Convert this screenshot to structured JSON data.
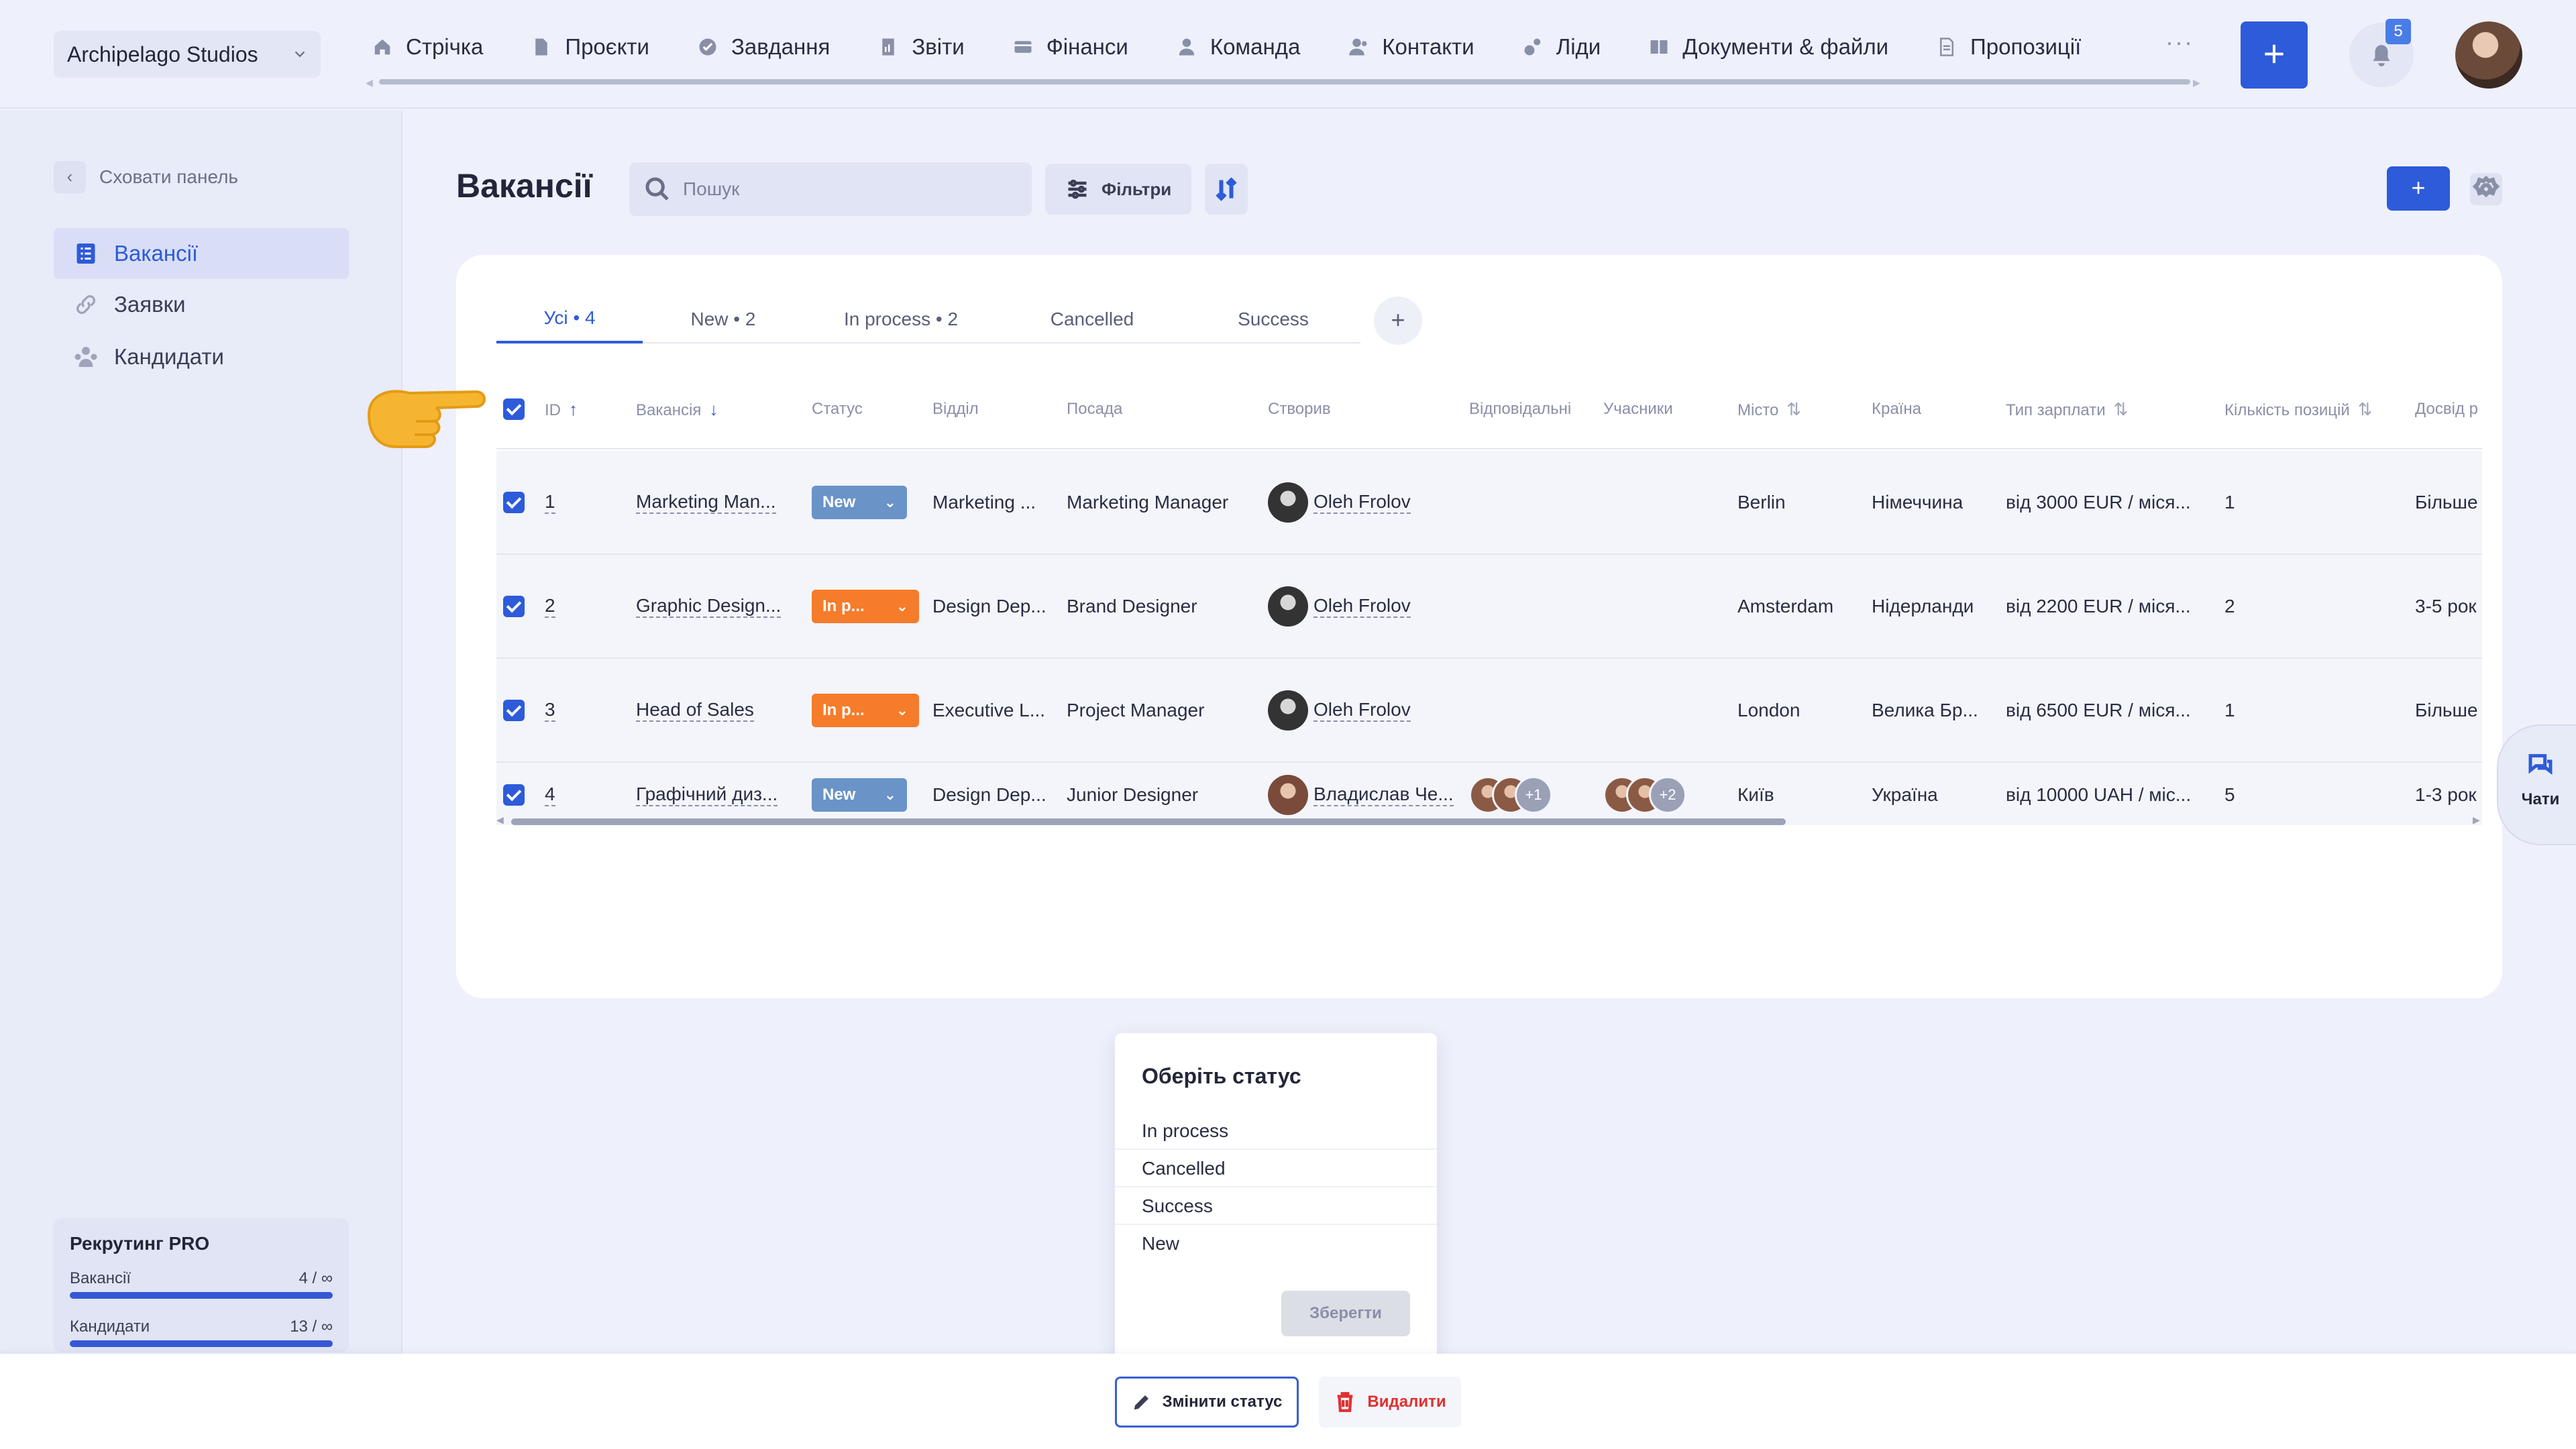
{
  "header": {
    "workspace": "Archipelago Studios",
    "nav": [
      {
        "label": "Стрічка",
        "icon": "home-icon"
      },
      {
        "label": "Проєкти",
        "icon": "file-icon"
      },
      {
        "label": "Завдання",
        "icon": "check-circle-icon"
      },
      {
        "label": "Звіти",
        "icon": "report-icon"
      },
      {
        "label": "Фінанси",
        "icon": "wallet-icon"
      },
      {
        "label": "Команда",
        "icon": "user-icon"
      },
      {
        "label": "Контакти",
        "icon": "contacts-icon"
      },
      {
        "label": "Ліди",
        "icon": "leads-icon"
      },
      {
        "label": "Документи & файли",
        "icon": "book-icon"
      },
      {
        "label": "Пропозиції",
        "icon": "document-icon"
      }
    ],
    "more": "···",
    "add_label": "+",
    "notifications_count": "5"
  },
  "sidebar": {
    "collapse_label": "Сховати панель",
    "items": [
      {
        "label": "Вакансії",
        "icon": "list-icon",
        "active": true
      },
      {
        "label": "Заявки",
        "icon": "link-icon",
        "active": false
      },
      {
        "label": "Кандидати",
        "icon": "people-icon",
        "active": false
      }
    ],
    "plan": {
      "title": "Рекрутинг PRO",
      "rows": [
        {
          "label": "Вакансії",
          "value": "4 / ∞"
        },
        {
          "label": "Кандидати",
          "value": "13 / ∞"
        }
      ]
    }
  },
  "main": {
    "title": "Вакансії",
    "search_placeholder": "Пошук",
    "filters_label": "Фільтри",
    "add_label": "+",
    "tabs": [
      "Усі • 4",
      "New • 2",
      "In process • 2",
      "Cancelled",
      "Success"
    ],
    "tab_add": "+",
    "columns": [
      "ID",
      "Вакансія",
      "Статус",
      "Відділ",
      "Посада",
      "Створив",
      "Відповідальні",
      "Учасники",
      "Місто",
      "Країна",
      "Тип зарплати",
      "Кількість позицій",
      "Досвід р"
    ],
    "rows": [
      {
        "id": "1",
        "vacancy": "Marketing Man...",
        "status": "New",
        "department": "Marketing ...",
        "position": "Marketing Manager",
        "creator": "Oleh Frolov",
        "responsible_more": "",
        "members_more": "",
        "city": "Berlin",
        "country": "Німеччина",
        "salary": "від 3000 EUR / міся...",
        "count": "1",
        "experience": "Більше"
      },
      {
        "id": "2",
        "vacancy": "Graphic Design...",
        "status": "In p...",
        "department": "Design Dep...",
        "position": "Brand Designer",
        "creator": "Oleh Frolov",
        "responsible_more": "",
        "members_more": "",
        "city": "Amsterdam",
        "country": "Нідерланди",
        "salary": "від 2200 EUR / міся...",
        "count": "2",
        "experience": "3-5 рок"
      },
      {
        "id": "3",
        "vacancy": "Head of Sales",
        "status": "In p...",
        "department": "Executive L...",
        "position": "Project Manager",
        "creator": "Oleh Frolov",
        "responsible_more": "",
        "members_more": "",
        "city": "London",
        "country": "Велика Бр...",
        "salary": "від 6500 EUR / міся...",
        "count": "1",
        "experience": "Більше"
      },
      {
        "id": "4",
        "vacancy": "Графічний диз...",
        "status": "New",
        "department": "Design Dep...",
        "position": "Junior Designer",
        "creator": "Владислав Че...",
        "responsible_more": "+1",
        "members_more": "+2",
        "city": "Київ",
        "country": "Україна",
        "salary": "від 10000 UAH / міс...",
        "count": "5",
        "experience": "1-3 рок"
      }
    ]
  },
  "chats_label": "Чати",
  "status_popup": {
    "title": "Оберіть статус",
    "options": [
      "In process",
      "Cancelled",
      "Success",
      "New"
    ],
    "save_label": "Зберегти"
  },
  "bottom_bar": {
    "change_status_label": "Змінити статус",
    "delete_label": "Видалити"
  },
  "colors": {
    "accent": "#2d5bd9",
    "status_new": "#6a93c8",
    "status_in_process": "#f57c2b",
    "danger": "#e03030"
  }
}
